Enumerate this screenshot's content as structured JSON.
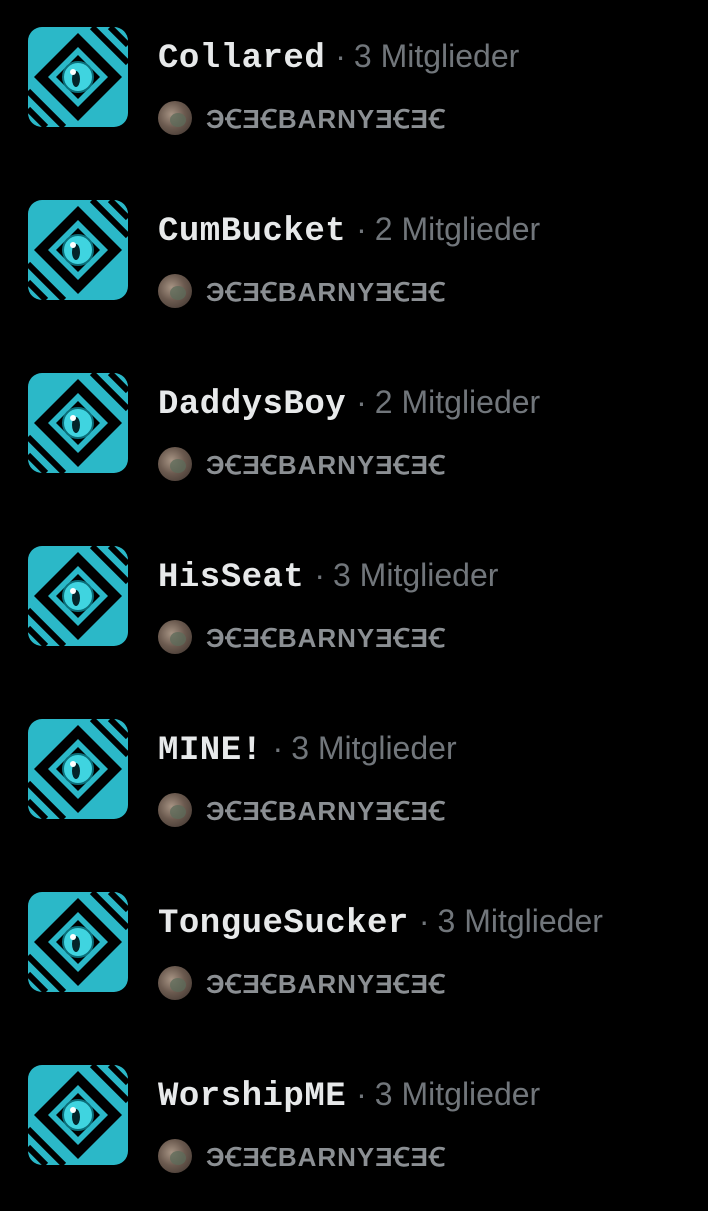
{
  "colors": {
    "background": "#000000",
    "name_text": "#e7e9ea",
    "meta_text": "#71767b",
    "icon_accent": "#2bb8c8"
  },
  "icon_name": "cat-eye-list-icon",
  "separator": "·",
  "lists": [
    {
      "name": "Collared",
      "members": "3 Mitglieder",
      "owner": "ЭꞒƎꞒBARNYƎꞒƎꞒ"
    },
    {
      "name": "CumBucket",
      "members": "2 Mitglieder",
      "owner": "ЭꞒƎꞒBARNYƎꞒƎꞒ"
    },
    {
      "name": "DaddysBoy",
      "members": "2 Mitglieder",
      "owner": "ЭꞒƎꞒBARNYƎꞒƎꞒ"
    },
    {
      "name": "HisSeat",
      "members": "3 Mitglieder",
      "owner": "ЭꞒƎꞒBARNYƎꞒƎꞒ"
    },
    {
      "name": "MINE!",
      "members": "3 Mitglieder",
      "owner": "ЭꞒƎꞒBARNYƎꞒƎꞒ"
    },
    {
      "name": "TongueSucker",
      "members": "3 Mitglieder",
      "owner": "ЭꞒƎꞒBARNYƎꞒƎꞒ"
    },
    {
      "name": "WorshipME",
      "members": "3 Mitglieder",
      "owner": "ЭꞒƎꞒBARNYƎꞒƎꞒ"
    }
  ]
}
